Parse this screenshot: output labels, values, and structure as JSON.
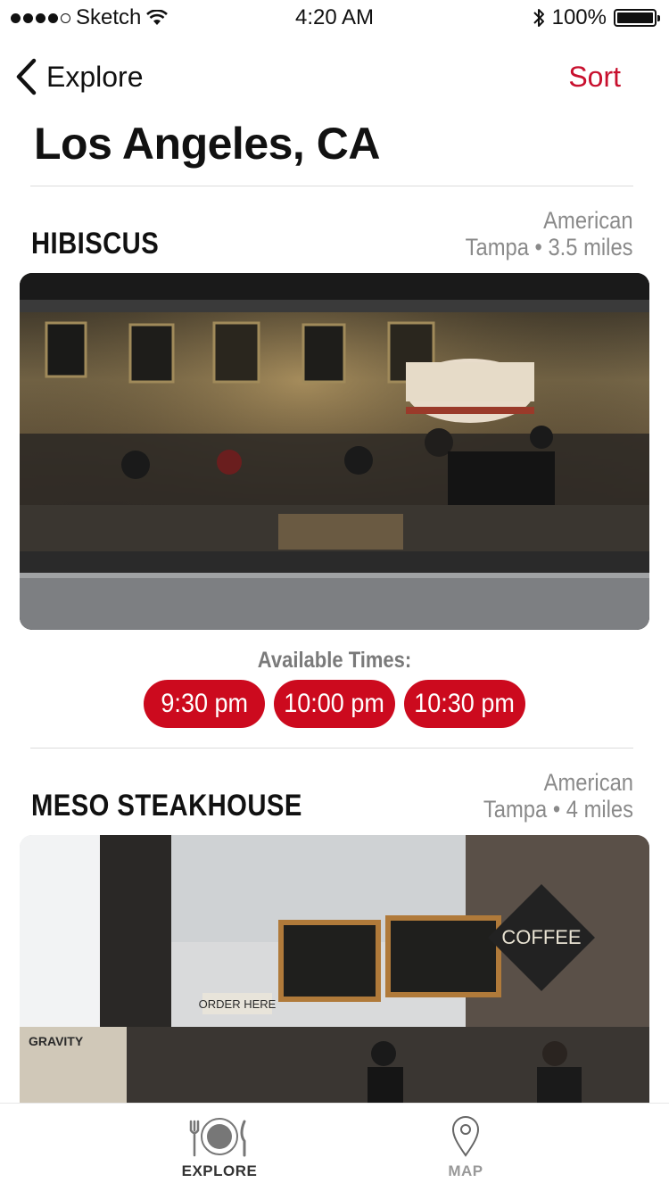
{
  "status_bar": {
    "carrier": "Sketch",
    "time": "4:20 AM",
    "battery_percent": "100%",
    "battery_level": 1.0
  },
  "nav": {
    "back_label": "Explore",
    "sort_label": "Sort",
    "accent_color": "#c8102e"
  },
  "page": {
    "title": "Los Angeles, CA"
  },
  "restaurants": [
    {
      "name": "HIBISCUS",
      "cuisine": "American",
      "location": "Tampa • 3.5 miles",
      "photo": "cafe-bar-interior-photo",
      "times_label": "Available Times:",
      "times": [
        "9:30 pm",
        "10:00 pm",
        "10:30 pm"
      ]
    },
    {
      "name": "MESO STEAKHOUSE",
      "cuisine": "American",
      "location": "Tampa • 4 miles",
      "photo": "coffee-shop-interior-photo",
      "signs": {
        "coffee": "COFFEE",
        "order": "ORDER HERE",
        "gravity": "GRAVITY"
      }
    }
  ],
  "tab_bar": {
    "items": [
      {
        "label": "EXPLORE",
        "icon": "plate-fork-knife-icon",
        "active": true
      },
      {
        "label": "MAP",
        "icon": "map-pin-icon",
        "active": false
      }
    ]
  }
}
